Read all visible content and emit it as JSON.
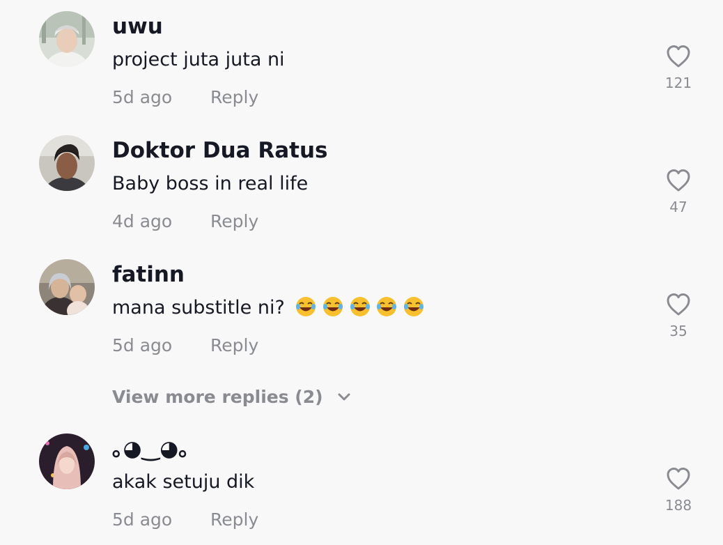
{
  "comments": [
    {
      "username": "uwu",
      "text": "project juta juta ni",
      "time": "5d ago",
      "reply_label": "Reply",
      "likes": "121",
      "avatar_icon": "avatar-photo"
    },
    {
      "username": "Doktor Dua Ratus",
      "text": "Baby boss in real life",
      "time": "4d ago",
      "reply_label": "Reply",
      "likes": "47",
      "avatar_icon": "avatar-photo"
    },
    {
      "username": "fatinn",
      "text": "mana substitle ni?",
      "emoji": "😂😂😂😂😂",
      "time": "5d ago",
      "reply_label": "Reply",
      "likes": "35",
      "avatar_icon": "avatar-photo"
    },
    {
      "username": "｡◕‿◕｡",
      "text": "akak setuju dik",
      "time": "5d ago",
      "reply_label": "Reply",
      "likes": "188",
      "avatar_icon": "avatar-photo"
    }
  ],
  "view_more": {
    "label": "View more replies (2)",
    "icon": "chevron-down-icon"
  },
  "colors": {
    "background": "#f8f8f8",
    "primary_text": "#161823",
    "secondary_text": "#8a8b91"
  }
}
